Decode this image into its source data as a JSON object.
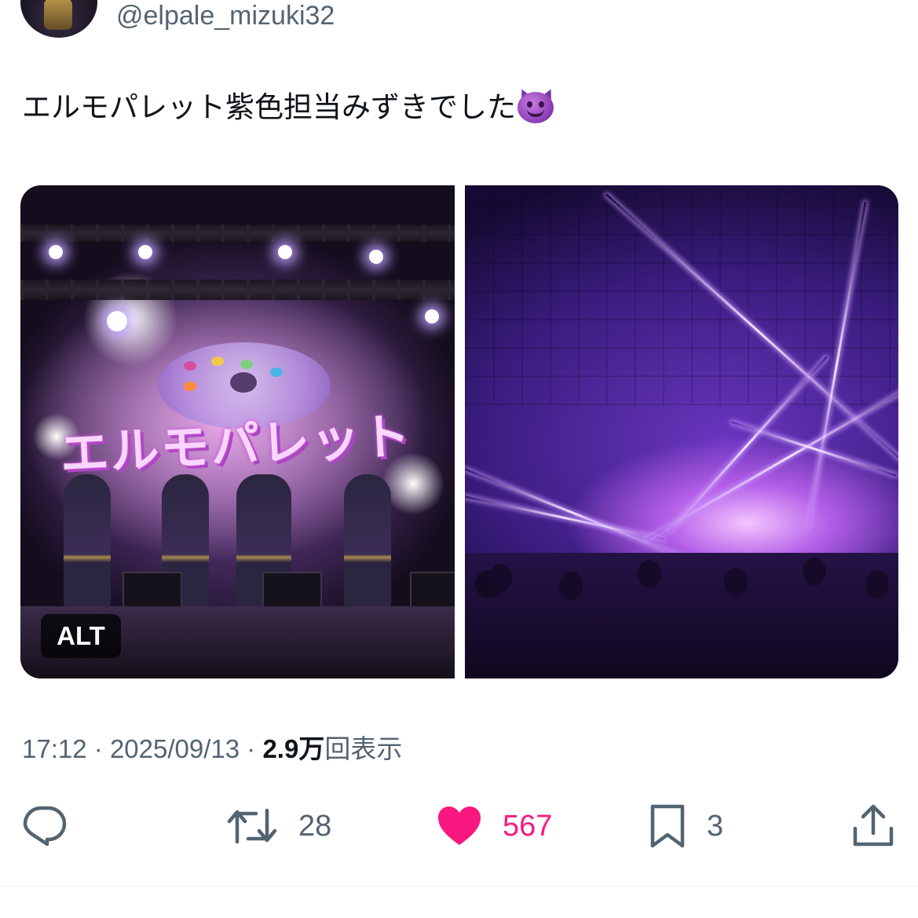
{
  "author": {
    "handle": "@elpale_mizuki32"
  },
  "tweet": {
    "text": "エルモパレット紫色担当みずきでした",
    "emoji": "smiling-imp-emoji"
  },
  "media": {
    "left_photo": {
      "alt_badge": "ALT",
      "logo_text": "エルモパレット"
    },
    "right_photo": {}
  },
  "meta": {
    "time": "17:12",
    "separator": "·",
    "date": "2025/09/13",
    "views_count": "2.9万",
    "views_label": "回表示"
  },
  "actions": {
    "reply": {
      "icon": "reply-icon"
    },
    "retweet": {
      "icon": "retweet-icon",
      "count": "28"
    },
    "like": {
      "icon": "heart-icon",
      "count": "567",
      "active": true
    },
    "bookmark": {
      "icon": "bookmark-icon",
      "count": "3"
    },
    "share": {
      "icon": "share-icon"
    }
  },
  "colors": {
    "text_primary": "#0f1419",
    "text_secondary": "#536471",
    "like_active": "#f91880",
    "divider": "#eff3f4"
  }
}
